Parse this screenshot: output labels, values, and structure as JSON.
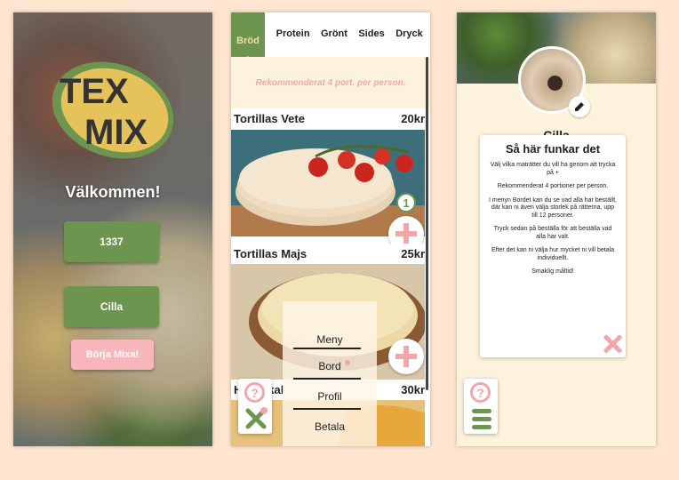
{
  "screen1": {
    "logo_line1": "TEX",
    "logo_line2": "MIX",
    "welcome": "Välkommen!",
    "table_button": "1337",
    "name_button": "Cilla",
    "start_button": "Börja Mixa!"
  },
  "screen2": {
    "tabs": [
      "Bröd",
      "Protein",
      "Grönt",
      "Sides",
      "Dryck"
    ],
    "recommendation": "Rekommenderat 4 port. per person.",
    "items": [
      {
        "name": "Tortillas Vete",
        "price": "20kr",
        "count": "1"
      },
      {
        "name": "Tortillas Majs",
        "price": "25kr"
      },
      {
        "name": "Hårt Skal",
        "price": "30kr"
      }
    ],
    "menu": [
      "Meny",
      "Bord",
      "Profil",
      "Betala"
    ],
    "help_icon": "?"
  },
  "screen3": {
    "profile_name": "Cilla",
    "modal_title": "Så här funkar det",
    "modal_paragraphs": [
      "Välj vilka maträtter du vill ha genom att trycka på +",
      "Rekommenderat 4 portioner per person.",
      "I menyn Bordet kan du se vad alla har beställt, där kan ni även välja storlek på rätterna, upp till 12 personer.",
      "Tryck sedan på beställa för att beställa vad alla har valt.",
      "Efter det kan ni välja hur mycket ni vill betala individuellt.",
      "Smaklig måltid!"
    ],
    "help_icon": "?"
  },
  "colors": {
    "green": "#6e9550",
    "pink": "#f7b6bb",
    "cream": "#fdf3dc",
    "background": "#fde5cf"
  }
}
